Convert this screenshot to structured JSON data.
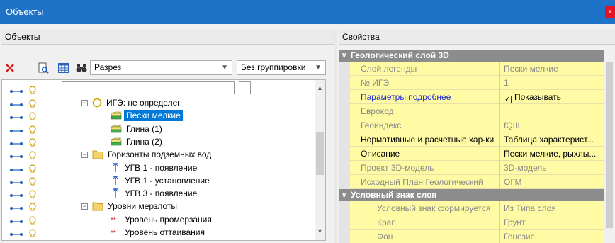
{
  "window": {
    "title": "Объекты",
    "close_glyph": "x"
  },
  "left_panel": {
    "header": "Объекты"
  },
  "right_panel": {
    "header": "Свойства"
  },
  "toolbar": {
    "delete_icon": "red-x-icon",
    "preview_icon": "magnifier-doc-icon",
    "table_icon": "table-icon",
    "find_icon": "binoculars-icon",
    "view_select": "Разрез",
    "grouping_select": "Без группировки",
    "accent": "#1e73c8"
  },
  "tree": [
    {
      "level": 1,
      "expander": "-",
      "icon": "circle",
      "label": "ИГЭ: не определен"
    },
    {
      "level": 2,
      "icon": "layer",
      "label": "Пески мелкие",
      "selected": true
    },
    {
      "level": 2,
      "icon": "layer",
      "label": "Глина (1)"
    },
    {
      "level": 2,
      "icon": "layer",
      "label": "Глина (2)"
    },
    {
      "level": 1,
      "expander": "-",
      "icon": "folder",
      "label": "Горизонты подземных вод"
    },
    {
      "level": 2,
      "icon": "water",
      "label": "УГВ 1 - появление"
    },
    {
      "level": 2,
      "icon": "water",
      "label": "УГВ 1 - установление"
    },
    {
      "level": 2,
      "icon": "water",
      "label": "УГВ 3 - появление"
    },
    {
      "level": 1,
      "expander": "-",
      "icon": "folder",
      "label": "Уровни мерзлоты"
    },
    {
      "level": 2,
      "icon": "frost",
      "label": "Уровень промерзания"
    },
    {
      "level": 2,
      "icon": "frost",
      "label": "Уровень оттаивания"
    }
  ],
  "properties": {
    "category1": "Геологический слой 3D",
    "rows1": [
      {
        "name": "Слой легенды",
        "value": "Пески мелкие",
        "dim": true
      },
      {
        "name": "№ ИГЭ",
        "value": "1",
        "dim": true
      },
      {
        "name": "Параметры подробнее",
        "value": "Показывать",
        "link": true,
        "checkbox": true
      },
      {
        "name": "Еврокод",
        "value": "",
        "dim": true
      },
      {
        "name": "Геоиндекс",
        "value": "fQIII",
        "dim": true
      },
      {
        "name": "Нормативные и расчетные хар-ки",
        "value": "Таблица характерист..."
      },
      {
        "name": "Описание",
        "value": "Пески мелкие, рыхлы..."
      },
      {
        "name": "Проект 3D-модель",
        "value": "3D-модель",
        "dim": true
      },
      {
        "name": "Исходный План Геологический",
        "value": "ОГМ",
        "dim": true
      }
    ],
    "category2": "Условный знак слоя",
    "rows2": [
      {
        "name": "Условный знак формируется",
        "value": "Из Типа слоя",
        "dim": true
      },
      {
        "name": "Крап",
        "value": "Грунт",
        "dim": true
      },
      {
        "name": "Фон",
        "value": "Генезис",
        "dim": true
      }
    ]
  }
}
